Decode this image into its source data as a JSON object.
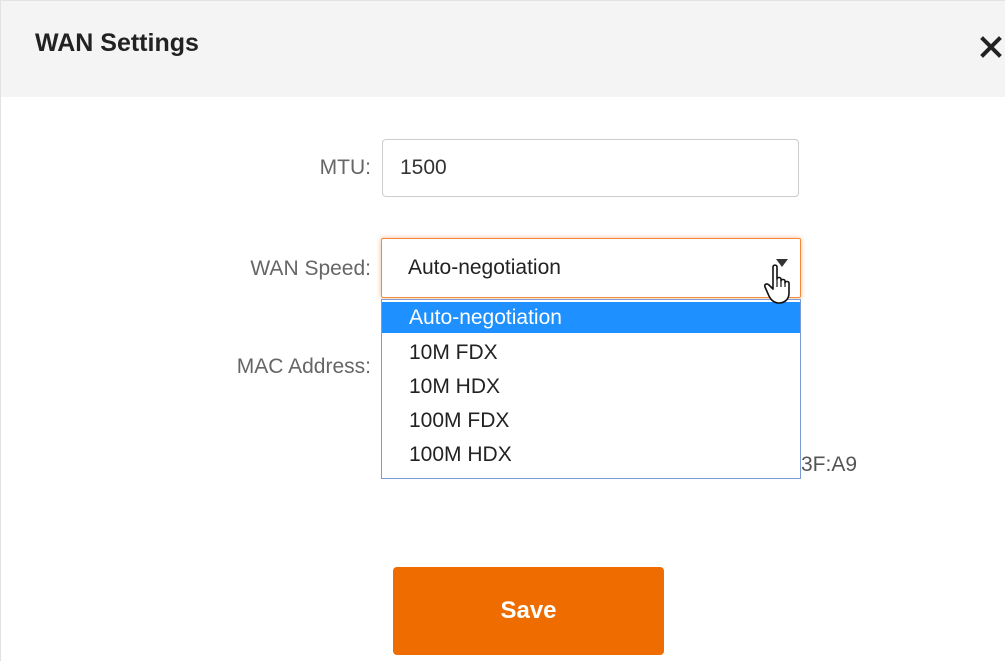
{
  "dialog": {
    "title": "WAN Settings",
    "close_icon": "close-icon"
  },
  "form": {
    "mtu": {
      "label": "MTU:",
      "value": "1500"
    },
    "wan_speed": {
      "label": "WAN Speed:",
      "selected": "Auto-negotiation",
      "options": [
        "Auto-negotiation",
        "10M FDX",
        "10M HDX",
        "100M FDX",
        "100M HDX"
      ],
      "highlighted_index": 0
    },
    "mac_address": {
      "label": "MAC Address:",
      "visible_value_fragment": "3F:A9"
    }
  },
  "actions": {
    "save_label": "Save"
  },
  "colors": {
    "accent": "#ef6c00",
    "focus_border": "#f08a3c",
    "option_highlight": "#1e90ff",
    "header_bg": "#f4f4f4"
  }
}
